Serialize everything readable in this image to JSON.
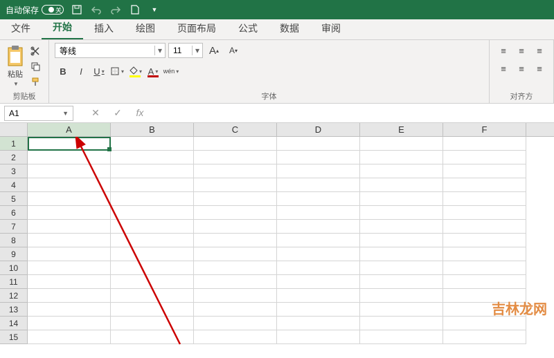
{
  "titlebar": {
    "autosave_label": "自动保存",
    "autosave_state": "关"
  },
  "tabs": {
    "file": "文件",
    "home": "开始",
    "insert": "插入",
    "draw": "绘图",
    "layout": "页面布局",
    "formulas": "公式",
    "data": "数据",
    "review": "审阅"
  },
  "ribbon": {
    "clipboard": {
      "paste": "粘贴",
      "label": "剪贴板"
    },
    "font": {
      "name": "等线",
      "size": "11",
      "bold": "B",
      "italic": "I",
      "underline": "U",
      "wen": "wén",
      "label": "字体",
      "increase": "A",
      "decrease": "A"
    },
    "align": {
      "label": "对齐方"
    }
  },
  "namebox": {
    "value": "A1",
    "fx": "fx"
  },
  "columns": [
    "A",
    "B",
    "C",
    "D",
    "E",
    "F"
  ],
  "rows": [
    "1",
    "2",
    "3",
    "4",
    "5",
    "6",
    "7",
    "8",
    "9",
    "10",
    "11",
    "12",
    "13",
    "14",
    "15"
  ],
  "active_cell": "A1",
  "watermark": "吉林龙网"
}
